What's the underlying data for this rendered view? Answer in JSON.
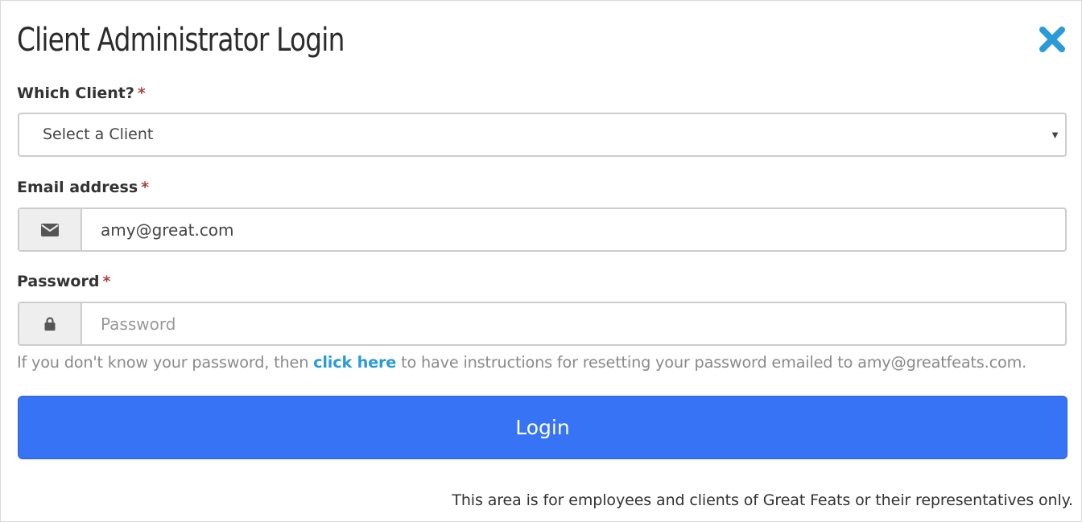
{
  "dialog": {
    "title": "Client Administrator Login",
    "close_icon": "close-icon"
  },
  "client": {
    "label": "Which Client?",
    "required_marker": "*",
    "selected": "Select a Client"
  },
  "email": {
    "label": "Email address",
    "required_marker": "*",
    "value": "amy@great.com",
    "icon": "envelope-icon"
  },
  "password": {
    "label": "Password",
    "required_marker": "*",
    "placeholder": "Password",
    "icon": "lock-icon"
  },
  "help": {
    "before": "If you don't know your password, then ",
    "link": "click here",
    "after": " to have instructions for resetting your password emailed to amy@greatfeats.com."
  },
  "login_button": "Login",
  "footer_note": "This area is for employees and clients of Great Feats or their representatives only.",
  "colors": {
    "accent": "#3773f5",
    "link": "#2a9bd8",
    "close": "#2a9bd8",
    "required": "#a94442"
  }
}
